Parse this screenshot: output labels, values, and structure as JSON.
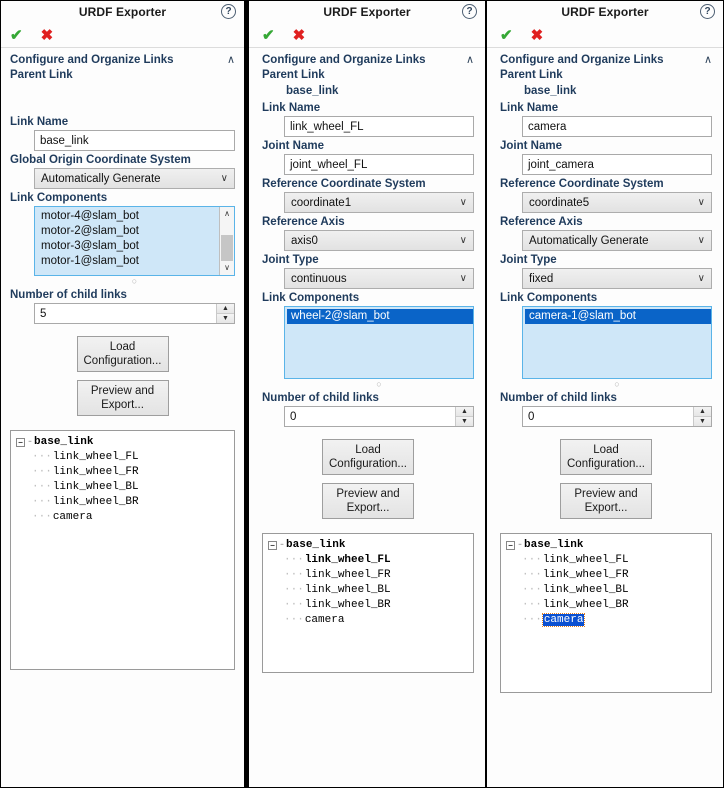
{
  "window": {
    "title": "URDF Exporter",
    "help_icon": "help-circle-icon",
    "accept_icon": "✔",
    "cancel_icon": "✖",
    "collapse_chevron": "∧",
    "combo_chevron": "∨",
    "spin_up": "▲",
    "spin_down": "▼",
    "scroll_up": "∧",
    "scroll_down": "∨",
    "grip": "○",
    "tree_collapse": "−"
  },
  "labels": {
    "section": "Configure and Organize Links",
    "parent_link": "Parent Link",
    "link_name": "Link Name",
    "joint_name": "Joint Name",
    "global_origin": "Global Origin Coordinate System",
    "reference_coordinate": "Reference Coordinate System",
    "reference_axis": "Reference Axis",
    "joint_type": "Joint Type",
    "link_components": "Link Components",
    "number_of_child_links": "Number of child links",
    "load_configuration": "Load Configuration...",
    "preview_and_export": "Preview and Export..."
  },
  "panels": [
    {
      "id": "panel-base-link",
      "parent_link_value": "",
      "link_name": "base_link",
      "joint_name": null,
      "global_origin_value": "Automatically Generate",
      "reference_coordinate": null,
      "reference_axis": null,
      "joint_type": null,
      "link_components": [
        "motor-4@slam_bot",
        "motor-2@slam_bot",
        "motor-3@slam_bot",
        "motor-1@slam_bot"
      ],
      "link_components_selected_index": -1,
      "has_scrollbar": true,
      "child_links_count": "5",
      "tree": {
        "root": "base_link",
        "children": [
          {
            "label": "link_wheel_FL",
            "bold": false,
            "highlighted": false
          },
          {
            "label": "link_wheel_FR",
            "bold": false,
            "highlighted": false
          },
          {
            "label": "link_wheel_BL",
            "bold": false,
            "highlighted": false
          },
          {
            "label": "link_wheel_BR",
            "bold": false,
            "highlighted": false
          },
          {
            "label": "camera",
            "bold": false,
            "highlighted": false
          }
        ]
      }
    },
    {
      "id": "panel-link-wheel-fl",
      "parent_link_value": "base_link",
      "link_name": "link_wheel_FL",
      "joint_name": "joint_wheel_FL",
      "global_origin_value": null,
      "reference_coordinate": "coordinate1",
      "reference_axis": "axis0",
      "joint_type": "continuous",
      "link_components": [
        "wheel-2@slam_bot"
      ],
      "link_components_selected_index": 0,
      "has_scrollbar": false,
      "child_links_count": "0",
      "tree": {
        "root": "base_link",
        "children": [
          {
            "label": "link_wheel_FL",
            "bold": true,
            "highlighted": false
          },
          {
            "label": "link_wheel_FR",
            "bold": false,
            "highlighted": false
          },
          {
            "label": "link_wheel_BL",
            "bold": false,
            "highlighted": false
          },
          {
            "label": "link_wheel_BR",
            "bold": false,
            "highlighted": false
          },
          {
            "label": "camera",
            "bold": false,
            "highlighted": false
          }
        ]
      }
    },
    {
      "id": "panel-camera",
      "parent_link_value": "base_link",
      "link_name": "camera",
      "joint_name": "joint_camera",
      "global_origin_value": null,
      "reference_coordinate": "coordinate5",
      "reference_axis": "Automatically Generate",
      "joint_type": "fixed",
      "link_components": [
        "camera-1@slam_bot"
      ],
      "link_components_selected_index": 0,
      "has_scrollbar": false,
      "child_links_count": "0",
      "tree": {
        "root": "base_link",
        "children": [
          {
            "label": "link_wheel_FL",
            "bold": false,
            "highlighted": false
          },
          {
            "label": "link_wheel_FR",
            "bold": false,
            "highlighted": false
          },
          {
            "label": "link_wheel_BL",
            "bold": false,
            "highlighted": false
          },
          {
            "label": "link_wheel_BR",
            "bold": false,
            "highlighted": false
          },
          {
            "label": "camera",
            "bold": false,
            "highlighted": true
          }
        ]
      }
    }
  ],
  "colors": {
    "label_blue": "#1f3b5c",
    "accept_green": "#36a836",
    "cancel_red": "#e02020",
    "listbox_bg": "#cfe7f8",
    "listbox_border": "#5ab4e8",
    "selection_blue": "#0a64c8",
    "tree_highlight": "#0a50d2",
    "focus_orange": "#e08020"
  }
}
